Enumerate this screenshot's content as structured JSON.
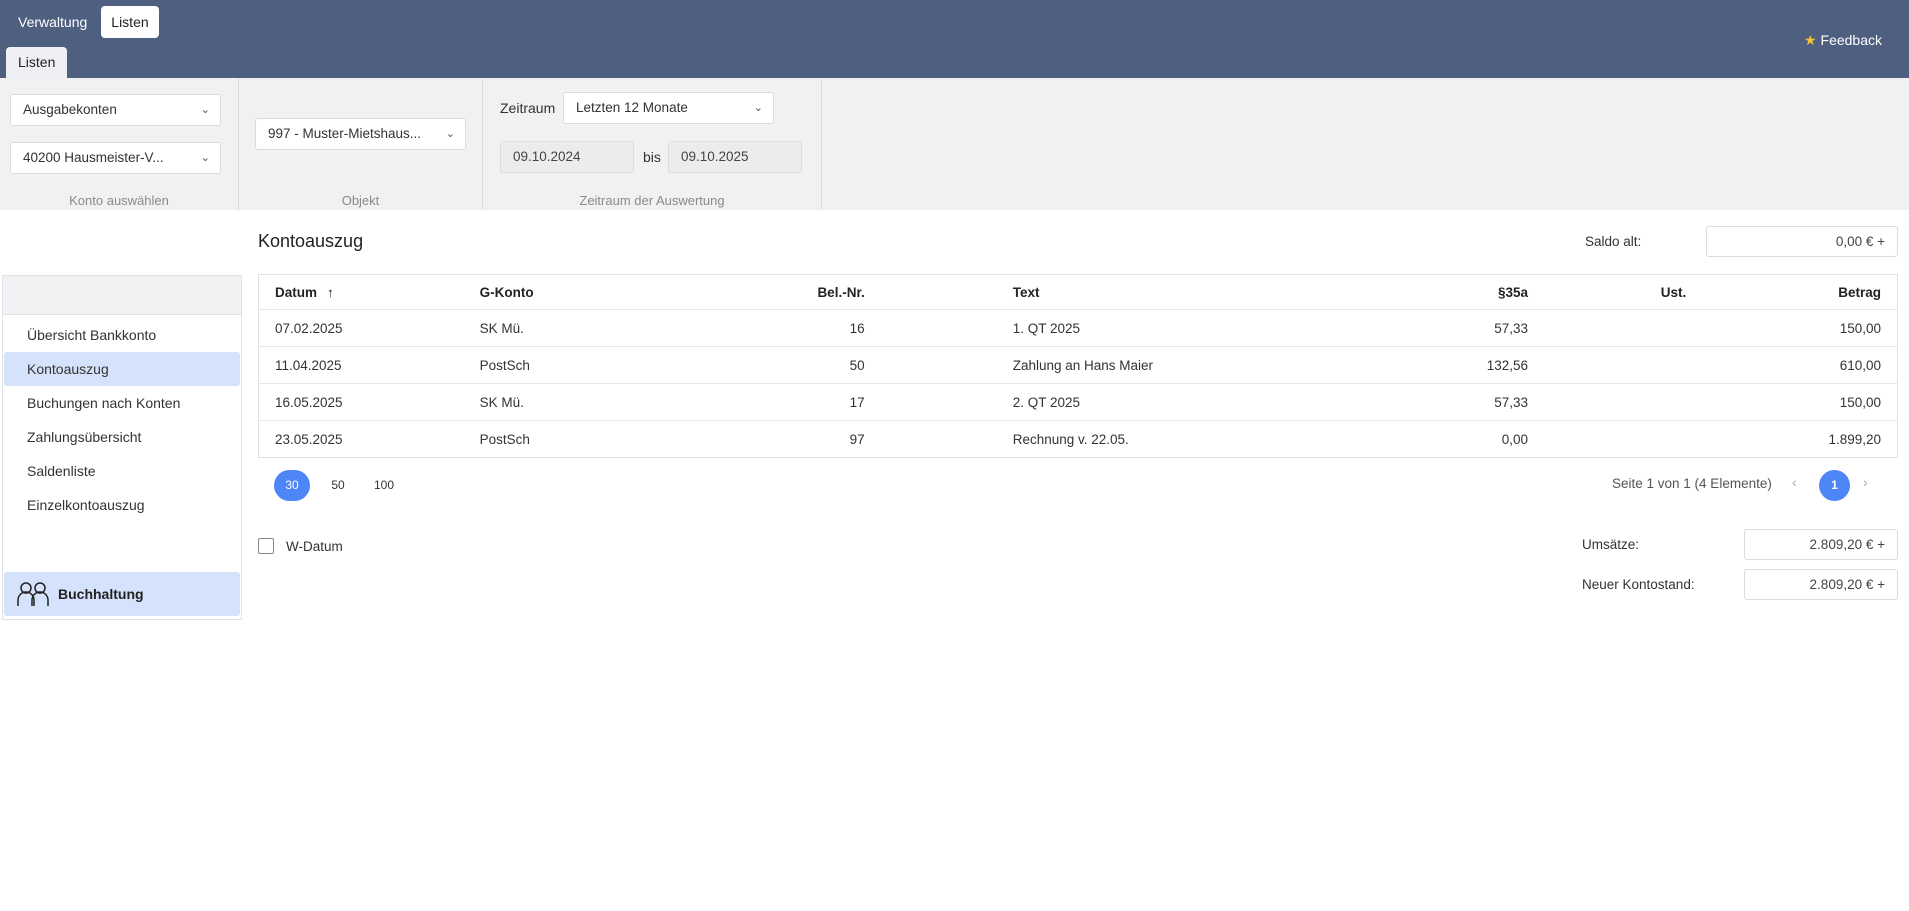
{
  "topnav": {
    "verwaltung": "Verwaltung",
    "listen": "Listen"
  },
  "subtab": "Listen",
  "feedback": {
    "star": "★",
    "label": "Feedback"
  },
  "filters": {
    "konto_typ": "Ausgabekonten",
    "konto": "40200    Hausmeister-V...",
    "konto_caption": "Konto auswählen",
    "objekt": "997 - Muster-Mietshaus...",
    "objekt_caption": "Objekt",
    "zeitraum_label": "Zeitraum",
    "zeitraum": "Letzten 12 Monate",
    "von": "09.10.2024",
    "bis_label": "bis",
    "bis": "09.10.2025",
    "zeitraum_caption": "Zeitraum der Auswertung"
  },
  "sidebar": {
    "items": [
      {
        "label": "Übersicht Bankkonto"
      },
      {
        "label": "Kontoauszug"
      },
      {
        "label": "Buchungen nach Konten"
      },
      {
        "label": "Zahlungsübersicht"
      },
      {
        "label": "Saldenliste"
      },
      {
        "label": "Einzelkontoauszug"
      }
    ],
    "active_index": 1,
    "footer": "Buchhaltung",
    "footer_icon": "people-icon"
  },
  "main": {
    "title": "Kontoauszug",
    "saldo_alt_label": "Saldo alt:",
    "saldo_alt": "0,00 € +"
  },
  "table": {
    "headers": {
      "datum": "Datum",
      "gkonto": "G-Konto",
      "beleg": "Bel.-Nr.",
      "text": "Text",
      "p35a": "§35a",
      "ust": "Ust.",
      "betrag": "Betrag"
    },
    "sort_icon": "↑",
    "rows": [
      {
        "datum": "07.02.2025",
        "gkonto": "SK Mü.",
        "beleg": "16",
        "text": "1. QT 2025",
        "p35a": "57,33",
        "ust": "",
        "betrag": "150,00"
      },
      {
        "datum": "11.04.2025",
        "gkonto": "PostSch",
        "beleg": "50",
        "text": "Zahlung an Hans Maier",
        "p35a": "132,56",
        "ust": "",
        "betrag": "610,00"
      },
      {
        "datum": "16.05.2025",
        "gkonto": "SK Mü.",
        "beleg": "17",
        "text": "2. QT 2025",
        "p35a": "57,33",
        "ust": "",
        "betrag": "150,00"
      },
      {
        "datum": "23.05.2025",
        "gkonto": "PostSch",
        "beleg": "97",
        "text": "Rechnung v. 22.05.",
        "p35a": "0,00",
        "ust": "",
        "betrag": "1.899,20"
      }
    ]
  },
  "pagination": {
    "sizes": [
      "30",
      "50",
      "100"
    ],
    "active_size": "30",
    "info": "Seite 1 von 1 (4 Elemente)",
    "prev": "‹",
    "next": "›",
    "current": "1"
  },
  "footer": {
    "wdatum_label": "W-Datum",
    "umsaetze_label": "Umsätze:",
    "umsaetze": "2.809,20 € +",
    "neuer_label": "Neuer Kontostand:",
    "neuer": "2.809,20 € +"
  },
  "colors": {
    "header": "#4f5f80",
    "accent": "#4f86f7",
    "active_bg": "#d5e2fb"
  }
}
